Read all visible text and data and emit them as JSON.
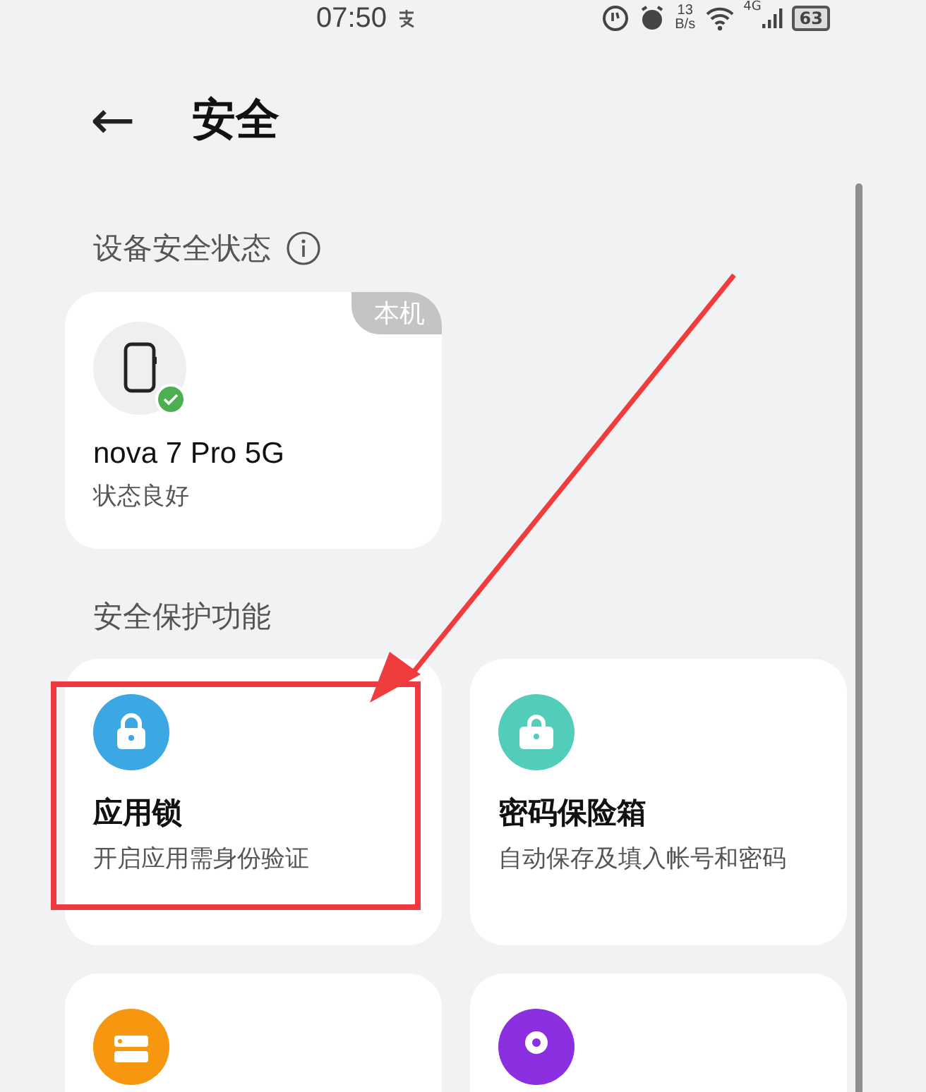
{
  "status_bar": {
    "time": "07:50",
    "speed_value": "13",
    "speed_unit": "B/s",
    "network": "4G",
    "battery": "63"
  },
  "header": {
    "back_icon": "←",
    "title": "安全"
  },
  "device_section": {
    "title": "设备安全状态",
    "device": {
      "badge": "本机",
      "name": "nova 7 Pro 5G",
      "status": "状态良好",
      "verified": true
    }
  },
  "feature_section": {
    "title": "安全保护功能",
    "features": [
      {
        "kind": "lock",
        "color": "#3ba7e3",
        "title": "应用锁",
        "subtitle": "开启应用需身份验证",
        "highlighted": true
      },
      {
        "kind": "vault",
        "color": "#52cdb9",
        "title": "密码保险箱",
        "subtitle": "自动保存及填入帐号和密码",
        "highlighted": false
      },
      {
        "kind": "drawer",
        "color": "#f7960f",
        "highlighted": false
      },
      {
        "kind": "pin",
        "color": "#8b2fe0",
        "highlighted": false
      }
    ]
  }
}
